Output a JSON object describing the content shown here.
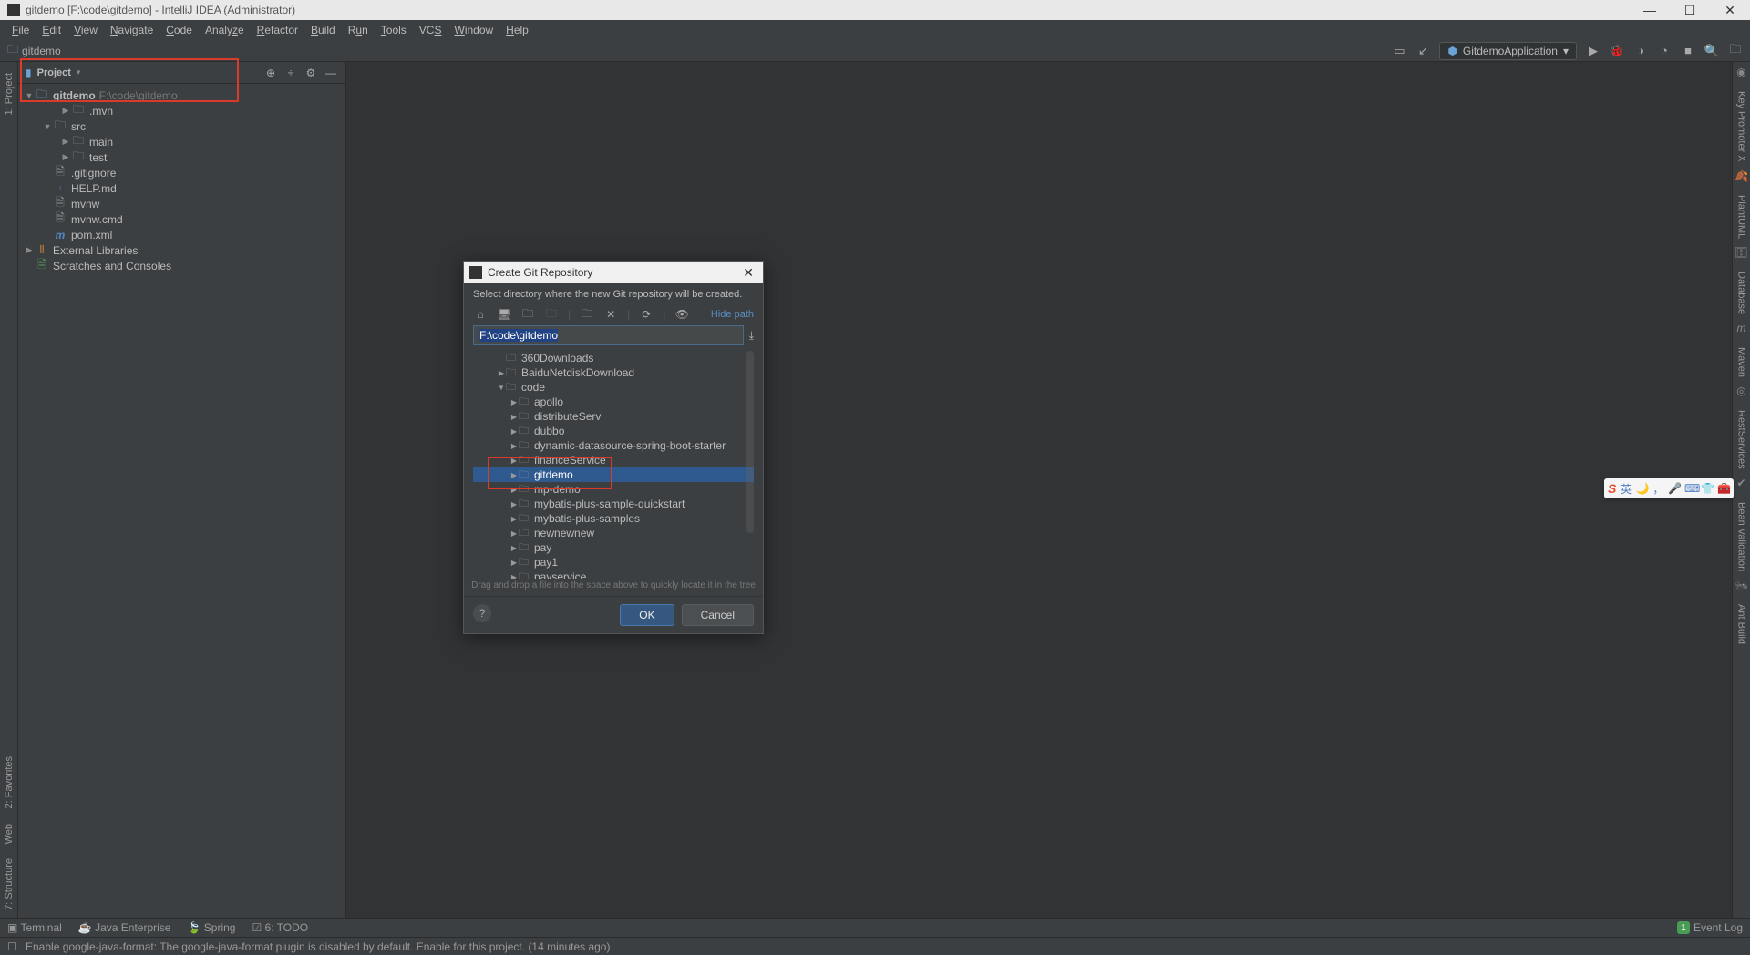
{
  "titlebar": {
    "text": "gitdemo [F:\\code\\gitdemo] - IntelliJ IDEA (Administrator)"
  },
  "menu": {
    "items": [
      "File",
      "Edit",
      "View",
      "Navigate",
      "Code",
      "Analyze",
      "Refactor",
      "Build",
      "Run",
      "Tools",
      "VCS",
      "Window",
      "Help"
    ]
  },
  "breadcrumb": {
    "project": "gitdemo"
  },
  "runconfig": {
    "name": "GitdemoApplication"
  },
  "project_panel": {
    "title": "Project",
    "root": {
      "name": "gitdemo",
      "path": "F:\\code\\gitdemo"
    },
    "nodes": [
      {
        "name": ".mvn",
        "type": "folder",
        "indent": 2,
        "arrow": "▶"
      },
      {
        "name": "src",
        "type": "folder",
        "indent": 1,
        "arrow": "▼"
      },
      {
        "name": "main",
        "type": "folder",
        "indent": 2,
        "arrow": "▶"
      },
      {
        "name": "test",
        "type": "folder",
        "indent": 2,
        "arrow": "▶"
      },
      {
        "name": ".gitignore",
        "type": "file",
        "indent": 1
      },
      {
        "name": "HELP.md",
        "type": "md",
        "indent": 1
      },
      {
        "name": "mvnw",
        "type": "file",
        "indent": 1
      },
      {
        "name": "mvnw.cmd",
        "type": "file",
        "indent": 1
      },
      {
        "name": "pom.xml",
        "type": "m",
        "indent": 1
      }
    ],
    "external": "External Libraries",
    "scratches": "Scratches and Consoles"
  },
  "right_tabs": [
    "Key Promoter X",
    "PlantUML",
    "Database",
    "Maven",
    "RestServices",
    "Bean Validation",
    "Ant Build"
  ],
  "left_tabs": [
    "1: Project",
    "2: Favorites",
    "Web",
    "7: Structure"
  ],
  "dialog": {
    "title": "Create Git Repository",
    "msg": "Select directory where the new Git repository will be created.",
    "hide_path": "Hide path",
    "path": "F:\\code\\gitdemo",
    "tree": [
      {
        "name": "360Downloads",
        "indent": 2,
        "arrow": ""
      },
      {
        "name": "BaiduNetdiskDownload",
        "indent": 2,
        "arrow": "▶"
      },
      {
        "name": "code",
        "indent": 2,
        "arrow": "▼"
      },
      {
        "name": "apollo",
        "indent": 3,
        "arrow": "▶"
      },
      {
        "name": "distributeServ",
        "indent": 3,
        "arrow": "▶"
      },
      {
        "name": "dubbo",
        "indent": 3,
        "arrow": "▶"
      },
      {
        "name": "dynamic-datasource-spring-boot-starter",
        "indent": 3,
        "arrow": "▶"
      },
      {
        "name": "financeService",
        "indent": 3,
        "arrow": "▶"
      },
      {
        "name": "gitdemo",
        "indent": 3,
        "arrow": "▶",
        "selected": true
      },
      {
        "name": "mp-demo",
        "indent": 3,
        "arrow": "▶"
      },
      {
        "name": "mybatis-plus-sample-quickstart",
        "indent": 3,
        "arrow": "▶"
      },
      {
        "name": "mybatis-plus-samples",
        "indent": 3,
        "arrow": "▶"
      },
      {
        "name": "newnewnew",
        "indent": 3,
        "arrow": "▶"
      },
      {
        "name": "pay",
        "indent": 3,
        "arrow": "▶"
      },
      {
        "name": "pay1",
        "indent": 3,
        "arrow": "▶"
      },
      {
        "name": "payservice",
        "indent": 3,
        "arrow": "▶"
      }
    ],
    "dragtip": "Drag and drop a file into the space above to quickly locate it in the tree",
    "ok": "OK",
    "cancel": "Cancel"
  },
  "bottom": {
    "terminal": "Terminal",
    "java_ee": "Java Enterprise",
    "spring": "Spring",
    "todo": "6: TODO",
    "eventlog": "Event Log",
    "eventcount": "1"
  },
  "status": {
    "msg": "Enable google-java-format: The google-java-format plugin is disabled by default. Enable for this project. (14 minutes ago)"
  },
  "ime": {
    "lang": "英"
  }
}
